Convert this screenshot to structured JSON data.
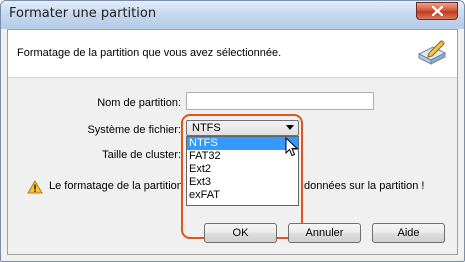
{
  "window": {
    "title": "Formater une partition"
  },
  "header": {
    "description": "Formatage de la partition que vous avez sélectionnée."
  },
  "form": {
    "partition_name_label": "Nom de partition:",
    "partition_name_value": "",
    "filesystem_label": "Système de fichier:",
    "filesystem_selected": "NTFS",
    "filesystem_options": [
      "NTFS",
      "FAT32",
      "Ext2",
      "Ext3",
      "exFAT"
    ],
    "cluster_size_label": "Taille de cluster:"
  },
  "warning": {
    "text_left": "Le formatage de la partition",
    "text_right": "données sur la partition !"
  },
  "buttons": {
    "ok": "OK",
    "cancel": "Annuler",
    "help": "Aide"
  },
  "colors": {
    "highlight_ring": "#e2541e",
    "selected_option": "#3399ff"
  },
  "icons": {
    "close": "close-icon",
    "header": "disk-edit-icon",
    "warning": "warning-icon",
    "dropdown": "chevron-down-icon",
    "cursor": "mouse-cursor-icon"
  }
}
